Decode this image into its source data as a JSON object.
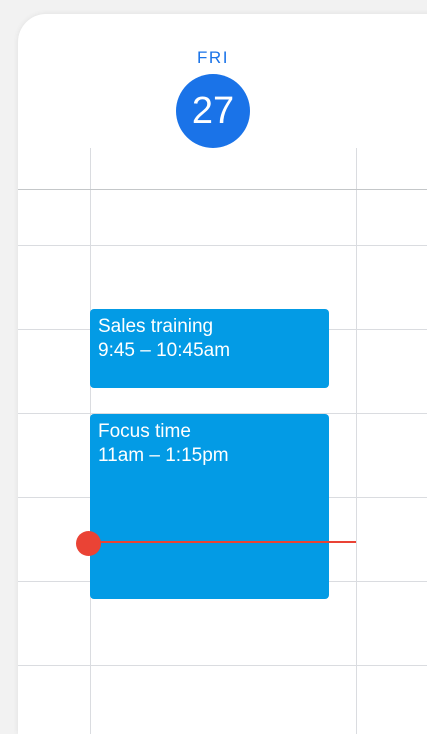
{
  "day_header": {
    "weekday": "FRI",
    "date": "27"
  },
  "events": [
    {
      "title": "Sales training",
      "time": "9:45 – 10:45am"
    },
    {
      "title": "Focus time",
      "time": "11am – 1:15pm"
    }
  ],
  "colors": {
    "accent": "#1a73e8",
    "event": "#039be5",
    "now_indicator": "#ea4335",
    "gridline": "#dadce0"
  }
}
